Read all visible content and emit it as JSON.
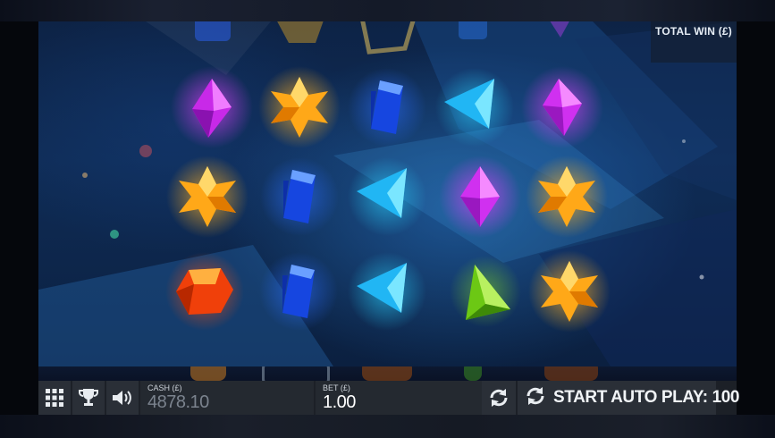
{
  "header": {
    "total_win_label": "TOTAL WIN (£)"
  },
  "toolbar": {
    "menu_icon": "grid-icon",
    "trophy_icon": "trophy-icon",
    "sound_icon": "speaker-icon",
    "cash_label": "CASH (£)",
    "cash_value": "4878.10",
    "bet_label": "BET (£)",
    "bet_value": "1.00",
    "quick_spin_icon": "refresh-icon",
    "auto_play_label": "START AUTO PLAY: 100"
  },
  "reels": {
    "rows": [
      [
        "purple-gem",
        "orange-star-gem",
        "blue-gem",
        "cyan-gem",
        "purple-gem"
      ],
      [
        "orange-star-gem",
        "blue-gem",
        "cyan-gem",
        "purple-gem",
        "orange-star-gem"
      ],
      [
        "red-gem",
        "blue-gem",
        "cyan-gem",
        "green-gem",
        "orange-star-gem"
      ]
    ]
  },
  "colors": {
    "toolbar_bg": "#1c2027",
    "button_bg": "#2a2f37",
    "cash_text": "#7b838e",
    "bet_text": "#ffffff",
    "purple": "#e040ff",
    "orange": "#ffb020",
    "blue": "#1a5cff",
    "cyan": "#28d4ff",
    "red": "#ff5010",
    "green": "#88e020"
  }
}
